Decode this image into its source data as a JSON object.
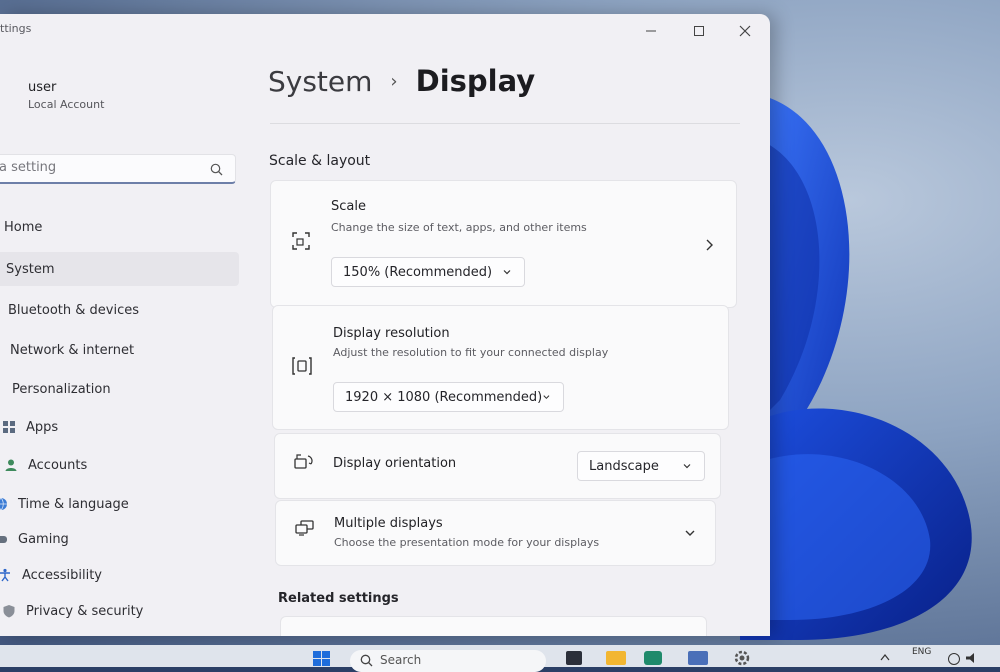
{
  "window": {
    "app_title": "ttings"
  },
  "user": {
    "name": "user",
    "account_type": "Local Account"
  },
  "search": {
    "placeholder": "a setting"
  },
  "nav": {
    "items": [
      {
        "label": "Home"
      },
      {
        "label": "System"
      },
      {
        "label": "Bluetooth & devices"
      },
      {
        "label": "Network & internet"
      },
      {
        "label": "Personalization"
      },
      {
        "label": "Apps"
      },
      {
        "label": "Accounts"
      },
      {
        "label": "Time & language"
      },
      {
        "label": "Gaming"
      },
      {
        "label": "Accessibility"
      },
      {
        "label": "Privacy & security"
      }
    ],
    "selected": "System"
  },
  "breadcrumb": {
    "parent": "System",
    "separator": "›",
    "current": "Display"
  },
  "scale_layout": {
    "title": "Scale & layout",
    "scale": {
      "title": "Scale",
      "subtitle": "Change the size of text, apps, and other items",
      "value": "150% (Recommended)"
    },
    "resolution": {
      "title": "Display resolution",
      "subtitle": "Adjust the resolution to fit your connected display",
      "value": "1920 × 1080 (Recommended)"
    },
    "orientation": {
      "title": "Display orientation",
      "value": "Landscape"
    },
    "multiple_displays": {
      "title": "Multiple displays",
      "subtitle": "Choose the presentation mode for your displays"
    }
  },
  "related": {
    "title": "Related settings"
  },
  "taskbar": {
    "search_label": "Search",
    "tray_language": "ENG"
  },
  "colors": {
    "accent": "#6d7fa8",
    "window_bg": "#f1f0f4",
    "card_bg": "#fafafb",
    "bloom_blue": "#1f4fd6"
  },
  "icons": {
    "search": "search-icon",
    "scale": "scale-icon",
    "resolution": "resolution-icon",
    "orientation": "orientation-icon",
    "multiple_displays": "multiple-displays-icon",
    "chevron_right": "chevron-right-icon",
    "chevron_down": "chevron-down-icon",
    "minimize": "minimize-icon",
    "maximize": "maximize-icon",
    "close": "close-icon"
  }
}
